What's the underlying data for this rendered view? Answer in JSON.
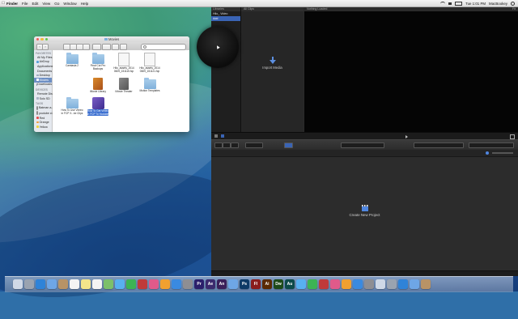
{
  "menubar": {
    "apple": "",
    "items": [
      "Finder",
      "File",
      "Edit",
      "View",
      "Go",
      "Window",
      "Help"
    ],
    "clock": "Tue 1:01 PM",
    "user": "MacBookey"
  },
  "finder": {
    "title": "Movies",
    "sidebar": {
      "favorites_header": "FAVORITES",
      "favorites": [
        "All My Files",
        "AirDrop",
        "Applications",
        "Documents",
        "Desktop",
        "Movies",
        "Downloads"
      ],
      "devices_header": "DEVICES",
      "devices": [
        "Remote Disc",
        "Solo SD"
      ],
      "tags_header": "TAGS",
      "tags": [
        "Batman a...",
        "youtube cl...",
        "Red",
        "Orange",
        "Yellow"
      ]
    },
    "files": [
      {
        "name": "Camtasia 2",
        "kind": "folder"
      },
      {
        "name": "Final Cut Pro Backups",
        "kind": "folder"
      },
      {
        "name": "Hilo_assets_2014 0609_151115.fcp",
        "kind": "doc"
      },
      {
        "name": "Hilo_assets_2014 0609_151121.fcp",
        "kind": "doc"
      },
      {
        "name": "iMovie Library",
        "kind": "book"
      },
      {
        "name": "iMovie Theater",
        "kind": "book"
      },
      {
        "name": "Motion Templates",
        "kind": "folder"
      },
      {
        "name": "How To Use Vimeo in FCP X...ke Clips",
        "kind": "folder"
      },
      {
        "name": "How To Get Vimeo in FCP To Youtube",
        "kind": "fcpx"
      }
    ]
  },
  "fcp": {
    "libraries_header": "Libraries",
    "library_rows": [
      "Hilo_ Video",
      "Add"
    ],
    "browser_header": "All Clips",
    "import_label": "Import Media",
    "viewer_title": "Nothing Loaded",
    "viewer_right": "Fit",
    "create_label": "Create New Project"
  },
  "dock": {
    "icons": [
      "finder-icon",
      "launchpad-icon",
      "safari-icon",
      "mail-icon",
      "contacts-icon",
      "calendar-icon",
      "notes-icon",
      "reminders-icon",
      "maps-icon",
      "messages-icon",
      "facetime-icon",
      "photo-booth-icon",
      "itunes-icon",
      "ibooks-icon",
      "app-store-icon",
      "preferences-icon",
      "premiere-icon",
      "after-effects-icon",
      "animate-icon",
      "camtasia-icon",
      "photoshop-icon",
      "flash-icon",
      "illustrator-icon",
      "dreamweaver-icon",
      "audition-icon",
      "final-cut-icon",
      "motion-icon",
      "compressor-icon",
      "imovie-icon",
      "garageband-icon",
      "vlc-icon",
      "handbrake-icon",
      "terminal-icon",
      "chrome-icon",
      "firefox-icon",
      "downloads-icon",
      "trash-icon"
    ],
    "labels": {
      "premiere-icon": "Pr",
      "after-effects-icon": "Ae",
      "animate-icon": "An",
      "photoshop-icon": "Ps",
      "flash-icon": "Fl",
      "illustrator-icon": "Ai",
      "dreamweaver-icon": "Dw",
      "audition-icon": "Au"
    }
  },
  "colors": {
    "premiere": "#2b1f6b",
    "after_effects": "#3b2a6e",
    "photoshop": "#0e3a66",
    "dreamweaver": "#1d4a1a",
    "flash": "#8a1d1d",
    "illustrator": "#5a2a00"
  }
}
